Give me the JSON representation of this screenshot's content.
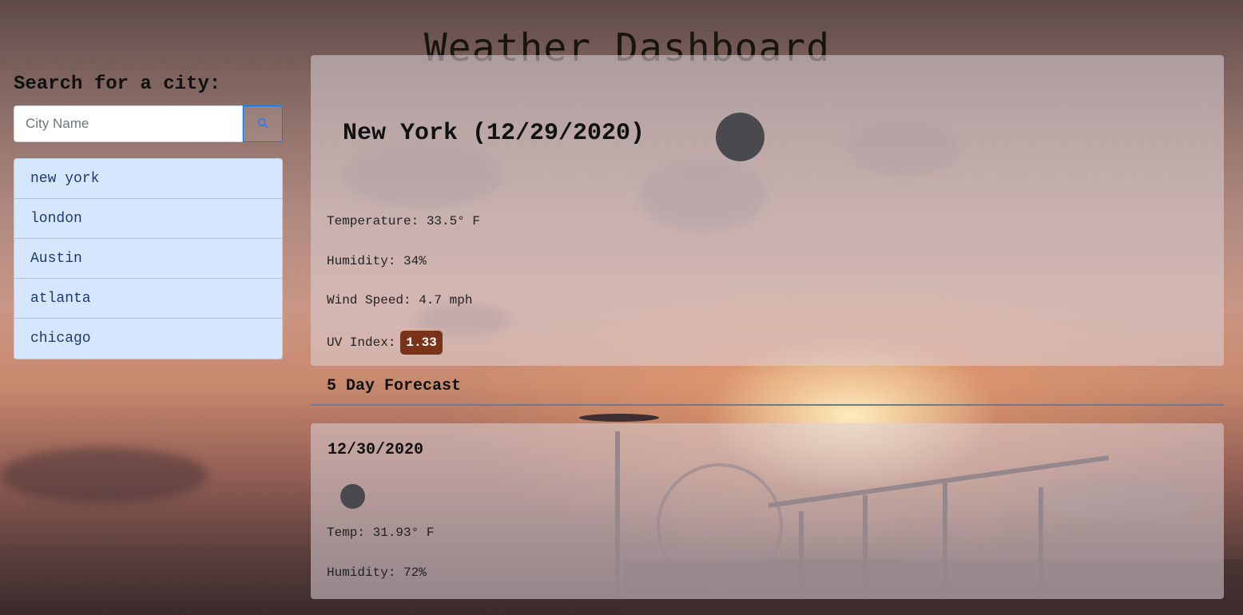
{
  "header": {
    "title": "Weather Dashboard"
  },
  "sidebar": {
    "heading": "Search for a city:",
    "search": {
      "placeholder": "City Name",
      "value": ""
    },
    "search_button_icon": "search-icon",
    "cities": [
      "new york",
      "london",
      "Austin",
      "atlanta",
      "chicago"
    ]
  },
  "current": {
    "heading": "New York (12/29/2020)",
    "icon": "weather-icon",
    "temperature": "Temperature: 33.5° F",
    "humidity": "Humidity: 34%",
    "wind": "Wind Speed: 4.7 mph",
    "uv_label": "UV Index:",
    "uv_value": "1.33",
    "uv_color": "#7a3318"
  },
  "forecast": {
    "heading": "5 Day Forecast",
    "days": [
      {
        "date": "12/30/2020",
        "icon": "weather-icon",
        "temp": "Temp: 31.93° F",
        "humidity": "Humidity: 72%"
      }
    ]
  },
  "colors": {
    "accent": "#007bff",
    "city_list_bg": "#d6e6fc"
  }
}
